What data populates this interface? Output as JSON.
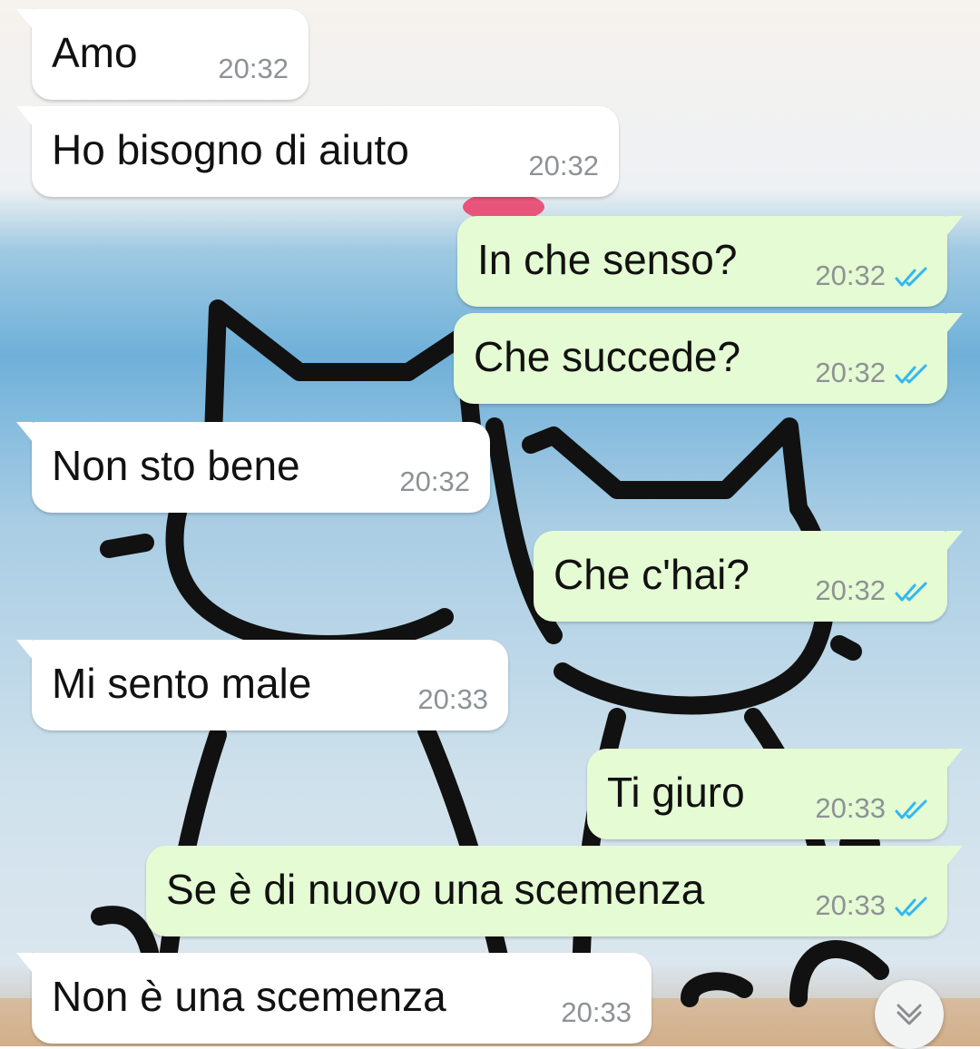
{
  "chat": {
    "messages": [
      {
        "direction": "in",
        "text": "Amo",
        "time": "20:32"
      },
      {
        "direction": "in",
        "text": "Ho bisogno di aiuto",
        "time": "20:32"
      },
      {
        "direction": "out",
        "text": "In che senso?",
        "time": "20:32",
        "status": "read"
      },
      {
        "direction": "out",
        "text": "Che succede?",
        "time": "20:32",
        "status": "read"
      },
      {
        "direction": "in",
        "text": "Non sto bene",
        "time": "20:32"
      },
      {
        "direction": "out",
        "text": "Che c'hai?",
        "time": "20:32",
        "status": "read"
      },
      {
        "direction": "in",
        "text": "Mi sento male",
        "time": "20:33"
      },
      {
        "direction": "out",
        "text": "Ti giuro",
        "time": "20:33",
        "status": "read"
      },
      {
        "direction": "out",
        "text": "Se è di nuovo una scemenza",
        "time": "20:33",
        "status": "read"
      },
      {
        "direction": "in",
        "text": "Non è una scemenza",
        "time": "20:33"
      }
    ]
  },
  "icons": {
    "read_receipt": "double-check-icon",
    "scroll_down": "double-chevron-down-icon"
  },
  "colors": {
    "incoming_bubble": "#ffffff",
    "outgoing_bubble": "#e4fbd3",
    "read_tick": "#34b7f1",
    "timestamp": "#8e9295"
  }
}
